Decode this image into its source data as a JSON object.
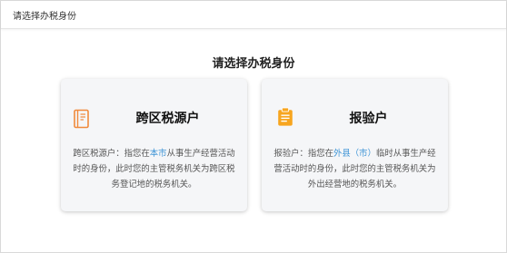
{
  "window": {
    "title": "请选择办税身份"
  },
  "main": {
    "heading": "请选择办税身份"
  },
  "cards": [
    {
      "icon": "document-icon",
      "accent": "#f08a3c",
      "title": "跨区税源户",
      "desc_before": "跨区税源户：指您在",
      "desc_highlight": "本市",
      "desc_after": "从事生产经营活动时的身份，此时您的主管税务机关为跨区税务登记地的税务机关。"
    },
    {
      "icon": "clipboard-icon",
      "accent": "#f7a51f",
      "title": "报验户",
      "desc_before": "报验户：指您在",
      "desc_highlight": "外县（市）",
      "desc_after": "临时从事生产经营活动时的身份，此时您的主管税务机关为外出经营地的税务机关。"
    }
  ],
  "colors": {
    "highlight": "#3e94d6",
    "card_bg": "#f5f6f8"
  }
}
